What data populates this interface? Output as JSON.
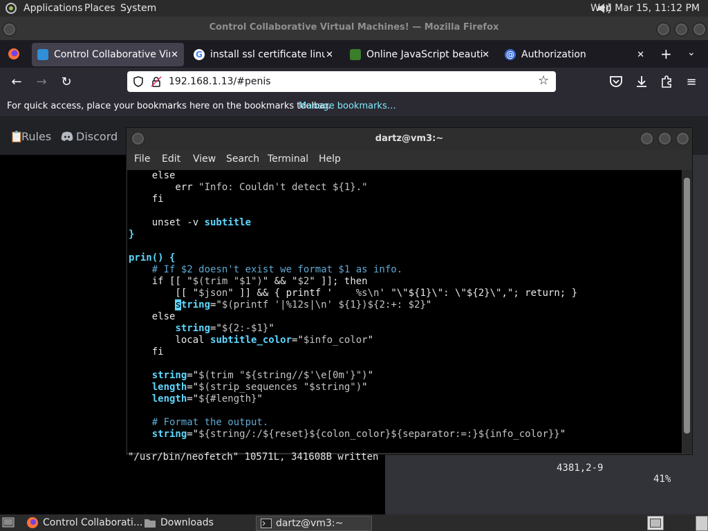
{
  "panel": {
    "menus": [
      "Applications",
      "Places",
      "System"
    ],
    "clock": "Wed Mar 15, 11:12 PM"
  },
  "firefox": {
    "title": "Control Collaborative Virtual Machines! — Mozilla Firefox",
    "tabs": [
      {
        "label": "Control Collaborative Virtual",
        "close": "✕",
        "active": true
      },
      {
        "label": "install ssl certificate linux - G",
        "close": "✕",
        "active": false
      },
      {
        "label": "Online JavaScript beautifier",
        "close": "✕",
        "active": false
      },
      {
        "label": "Authorization",
        "close": "✕",
        "active": false
      }
    ],
    "url": "192.168.1.13/#penis",
    "bookmarks_text": "For quick access, place your bookmarks here on the bookmarks toolbar.",
    "bookmarks_link": "Manage bookmarks…"
  },
  "webpage": {
    "nav_items": [
      "Rules",
      "Discord"
    ]
  },
  "terminal": {
    "title": "dartz@vm3:~",
    "menu": [
      "File",
      "Edit",
      "View",
      "Search",
      "Terminal",
      "Help"
    ],
    "status_left": "\"/usr/bin/neofetch\" 10571L, 341608B written",
    "status_pos": "4381,2-9",
    "status_pct": "41%"
  },
  "taskbar": {
    "items": [
      "Control Collaborati...",
      "Downloads",
      "dartz@vm3:~"
    ]
  },
  "colors": {
    "panel": "#2b2b2b",
    "tabbar": "#1c1b22",
    "navbar": "#2b2a33",
    "code_identifier": "#5fd7ff",
    "code_comment": "#5fa8d3",
    "link": "#80ebff"
  }
}
